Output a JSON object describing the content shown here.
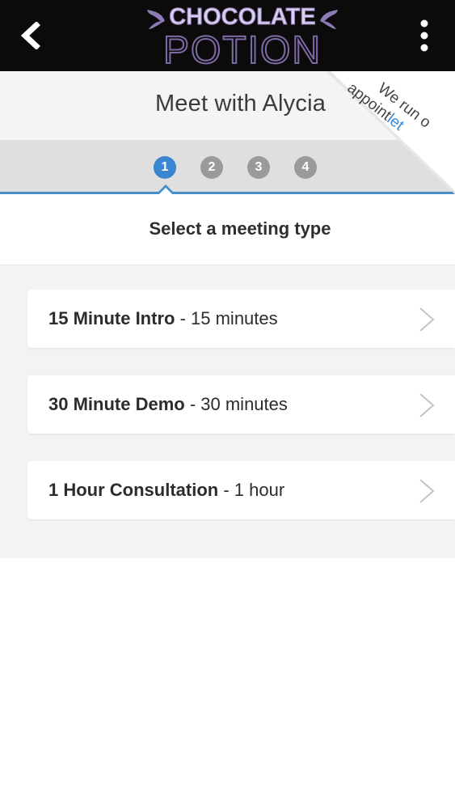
{
  "header": {
    "logo_line1": "CHOCOLATE",
    "logo_line2": "POTION",
    "back_icon": "chevron-left-icon",
    "menu_icon": "vertical-dots-icon"
  },
  "page": {
    "title": "Meet with Alycia"
  },
  "ribbon": {
    "line1": "We run o",
    "line2_prefix": "appoint",
    "line2_brand": "let"
  },
  "steps": [
    {
      "number": "1",
      "active": true
    },
    {
      "number": "2",
      "active": false
    },
    {
      "number": "3",
      "active": false
    },
    {
      "number": "4",
      "active": false
    }
  ],
  "section": {
    "title": "Select a meeting type"
  },
  "meeting_types": [
    {
      "name": "15 Minute Intro",
      "separator": " - ",
      "duration": "15 minutes"
    },
    {
      "name": "30 Minute Demo",
      "separator": " - ",
      "duration": "30 minutes"
    },
    {
      "name": "1 Hour Consultation",
      "separator": " - ",
      "duration": "1 hour"
    }
  ],
  "colors": {
    "topbar": "#0b0b0b",
    "accent": "#3a86d1",
    "inactive_step": "#9a9a9a",
    "logo_fill": "#cfc3e6",
    "logo_outline": "#8e7bb5"
  }
}
